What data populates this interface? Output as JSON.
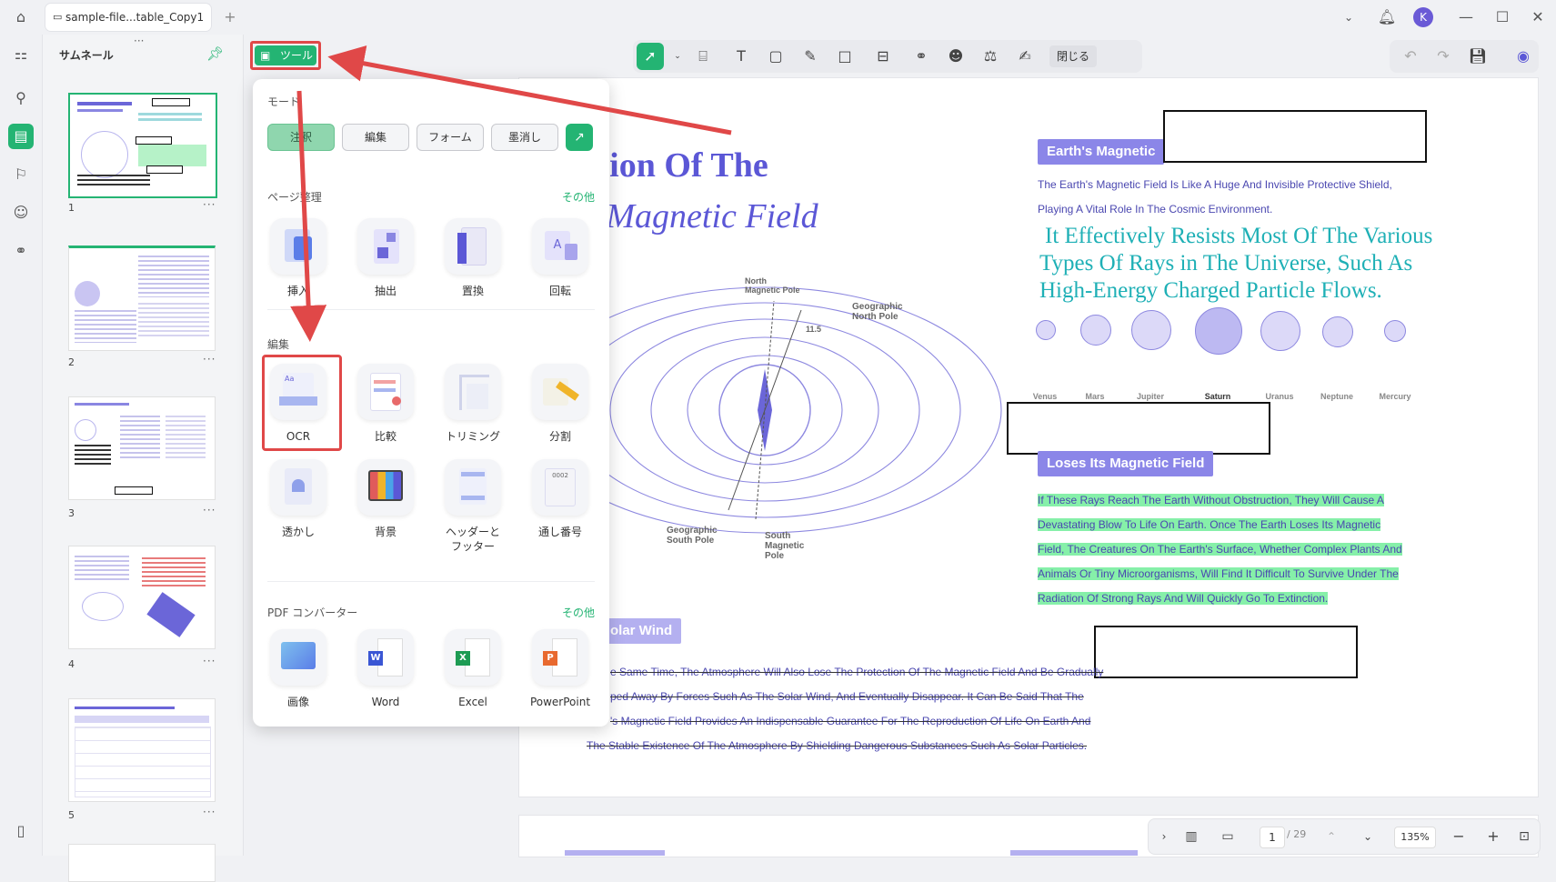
{
  "titlebar": {
    "tab_label": "sample-file...table_Copy1",
    "avatar_letter": "K"
  },
  "thumbnails": {
    "title": "サムネール",
    "pages": [
      "1",
      "2",
      "3",
      "4",
      "5"
    ]
  },
  "toolbar": {
    "tools_button": "ツール",
    "close_label": "閉じる"
  },
  "panel": {
    "mode_title": "モード",
    "modes": [
      "注釈",
      "編集",
      "フォーム",
      "墨消し"
    ],
    "page_title": "ページ整理",
    "page_more": "その他",
    "page_items": [
      "挿入",
      "抽出",
      "置換",
      "回転"
    ],
    "edit_title": "編集",
    "edit_items": [
      "OCR",
      "比較",
      "トリミング",
      "分割"
    ],
    "edit_items2": [
      "透かし",
      "背景",
      "ヘッダーと\nフッター",
      "通し番号"
    ],
    "convert_title": "PDF コンバーター",
    "convert_more": "その他",
    "convert_items": [
      "画像",
      "Word",
      "Excel",
      "PowerPoint"
    ]
  },
  "document": {
    "title1": "ormation Of The",
    "title2": "arth’s Magnetic Field",
    "tag1": "Earth's Magnetic",
    "para1_line1": "The Earth's Magnetic Field Is Like A Huge And Invisible Protective Shield,",
    "para1_line2": "Playing A Vital Role In The Cosmic Environment.",
    "big1": "It Effectively Resists Most Of The Various",
    "big2": "Types Of Rays in The Universe, Such As",
    "big3": "High-Energy Charged Particle Flows.",
    "planets": [
      "Venus",
      "Mars",
      "Jupiter",
      "Saturn",
      "Uranus",
      "Neptune",
      "Mercury"
    ],
    "diagram_labels": {
      "north_mag": "North\nMagnetic Pole",
      "geo_north": "Geographic\nNorth Pole",
      "angle": "11.5",
      "geo_south": "Geographic\nSouth Pole",
      "south_mag": "South\nMagnetic\nPole"
    },
    "tag2": "Loses Its Magnetic Field",
    "hl_lines": [
      "If These Rays Reach The Earth Without Obstruction, They Will Cause A",
      "Devastating Blow To Life On Earth. Once The Earth Loses Its Magnetic",
      "Field, The Creatures On The Earth's Surface, Whether Complex Plants And",
      "Animals Or Tiny Microorganisms, Will Find It Difficult To Survive Under The",
      "Radiation Of Strong Rays And Will Quickly Go To Extinction."
    ],
    "tag3": "olar Wind",
    "strike_lines": [
      "e Same Time, The Atmosphere Will Also Lose The Protection Of The Magnetic Field And Be Gradually",
      "ped Away By Forces Such As The Solar Wind, And Eventually Disappear. It Can Be Said That The",
      "'s Magnetic Field Provides An Indispensable Guarantee For The Reproduction Of Life On Earth And",
      "The Stable Existence Of The Atmosphere By Shielding Dangerous Substances Such As Solar Particles."
    ]
  },
  "bottombar": {
    "page_current": "1",
    "page_total": "/ 29",
    "zoom": "135%"
  },
  "colors": {
    "accent_green": "#24b473",
    "arrow_red": "#e04848",
    "doc_purple": "#5b57d6",
    "doc_teal": "#1fb0b6"
  }
}
